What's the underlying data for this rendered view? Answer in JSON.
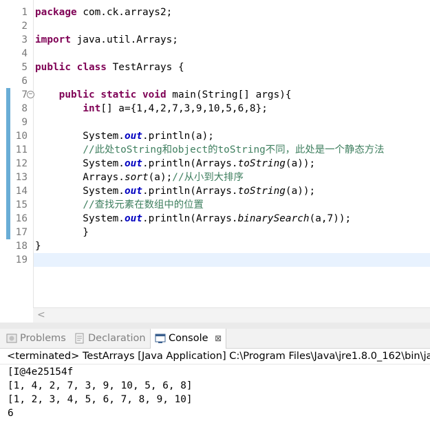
{
  "editor": {
    "lines": [
      {
        "n": "1",
        "parts": [
          {
            "t": "package",
            "c": "kw"
          },
          {
            "t": " com.ck.arrays2;",
            "c": ""
          }
        ]
      },
      {
        "n": "2",
        "parts": []
      },
      {
        "n": "3",
        "parts": [
          {
            "t": "import",
            "c": "kw"
          },
          {
            "t": " java.util.Arrays;",
            "c": ""
          }
        ]
      },
      {
        "n": "4",
        "parts": []
      },
      {
        "n": "5",
        "parts": [
          {
            "t": "public",
            "c": "kw"
          },
          {
            "t": " ",
            "c": ""
          },
          {
            "t": "class",
            "c": "kw"
          },
          {
            "t": " TestArrays {",
            "c": ""
          }
        ]
      },
      {
        "n": "6",
        "parts": []
      },
      {
        "n": "7",
        "parts": [
          {
            "t": "    ",
            "c": ""
          },
          {
            "t": "public",
            "c": "kw"
          },
          {
            "t": " ",
            "c": ""
          },
          {
            "t": "static",
            "c": "kw"
          },
          {
            "t": " ",
            "c": ""
          },
          {
            "t": "void",
            "c": "kw"
          },
          {
            "t": " main(String[] args){",
            "c": ""
          }
        ]
      },
      {
        "n": "8",
        "parts": [
          {
            "t": "        ",
            "c": ""
          },
          {
            "t": "int",
            "c": "kw"
          },
          {
            "t": "[] a={1,4,2,7,3,9,10,5,6,8};",
            "c": ""
          }
        ]
      },
      {
        "n": "9",
        "parts": []
      },
      {
        "n": "10",
        "parts": [
          {
            "t": "        System.",
            "c": ""
          },
          {
            "t": "out",
            "c": "fld"
          },
          {
            "t": ".println(a);",
            "c": ""
          }
        ]
      },
      {
        "n": "11",
        "parts": [
          {
            "t": "        ",
            "c": ""
          },
          {
            "t": "//此处toString和object的toString不同，此处是一个静态方法",
            "c": "cmt"
          }
        ]
      },
      {
        "n": "12",
        "parts": [
          {
            "t": "        System.",
            "c": ""
          },
          {
            "t": "out",
            "c": "fld"
          },
          {
            "t": ".println(Arrays.",
            "c": ""
          },
          {
            "t": "toString",
            "c": "stm"
          },
          {
            "t": "(a));",
            "c": ""
          }
        ]
      },
      {
        "n": "13",
        "parts": [
          {
            "t": "        Arrays.",
            "c": ""
          },
          {
            "t": "sort",
            "c": "stm"
          },
          {
            "t": "(a);",
            "c": ""
          },
          {
            "t": "//从小到大排序",
            "c": "cmt"
          }
        ]
      },
      {
        "n": "14",
        "parts": [
          {
            "t": "        System.",
            "c": ""
          },
          {
            "t": "out",
            "c": "fld"
          },
          {
            "t": ".println(Arrays.",
            "c": ""
          },
          {
            "t": "toString",
            "c": "stm"
          },
          {
            "t": "(a));",
            "c": ""
          }
        ]
      },
      {
        "n": "15",
        "parts": [
          {
            "t": "        ",
            "c": ""
          },
          {
            "t": "//查找元素在数组中的位置",
            "c": "cmt"
          }
        ]
      },
      {
        "n": "16",
        "parts": [
          {
            "t": "        System.",
            "c": ""
          },
          {
            "t": "out",
            "c": "fld"
          },
          {
            "t": ".println(Arrays.",
            "c": ""
          },
          {
            "t": "binarySearch",
            "c": "stm"
          },
          {
            "t": "(a,7));",
            "c": ""
          }
        ]
      },
      {
        "n": "17",
        "parts": [
          {
            "t": "        }",
            "c": ""
          }
        ]
      },
      {
        "n": "18",
        "parts": [
          {
            "t": "}",
            "c": ""
          }
        ]
      },
      {
        "n": "19",
        "parts": []
      }
    ],
    "changed_lines": [
      "7",
      "8",
      "9",
      "10",
      "11",
      "12",
      "13",
      "14",
      "15",
      "16",
      "17"
    ],
    "fold_line": "7",
    "fold_symbol": "⊖",
    "current_line": "19",
    "scroll_left_arrow": "<"
  },
  "tabs": [
    {
      "label": "Problems",
      "icon": "problems-icon",
      "active": false
    },
    {
      "label": "Declaration",
      "icon": "declaration-icon",
      "active": false
    },
    {
      "label": "Console",
      "icon": "console-icon",
      "active": true,
      "close": "⊠"
    }
  ],
  "console": {
    "header": "<terminated> TestArrays [Java Application] C:\\Program Files\\Java\\jre1.8.0_162\\bin\\ja",
    "output": [
      "[I@4e25154f",
      "[1, 4, 2, 7, 3, 9, 10, 5, 6, 8]",
      "[1, 2, 3, 4, 5, 6, 7, 8, 9, 10]",
      "6"
    ]
  },
  "colors": {
    "keyword": "#7f0055",
    "comment": "#3f7f5f",
    "field": "#0000c0",
    "change_bar": "#4f9fcf",
    "current_line": "#e8f2fe"
  }
}
